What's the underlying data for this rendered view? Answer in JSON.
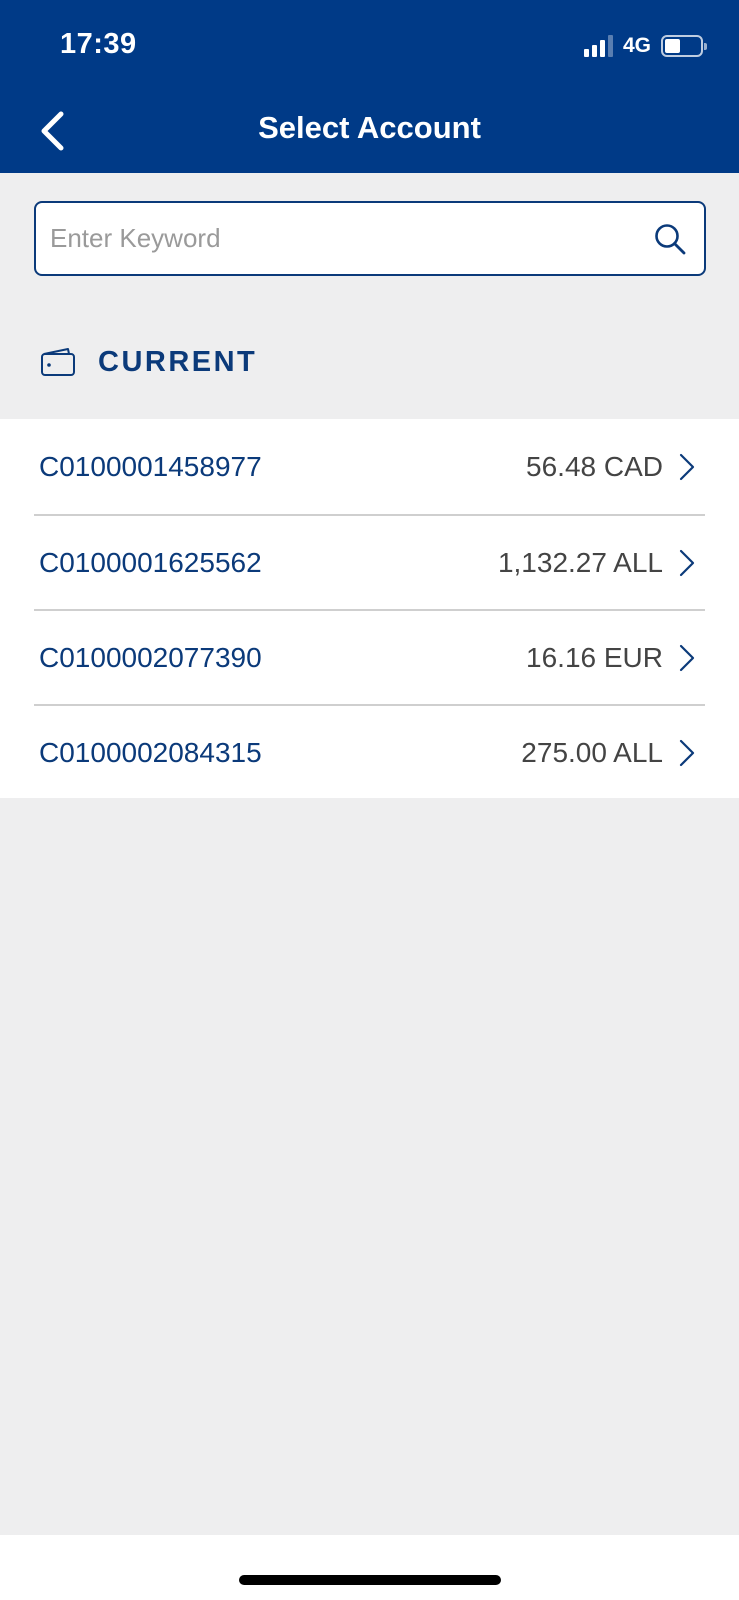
{
  "status_bar": {
    "time": "17:39",
    "network": "4G",
    "signal_bars_active": 3,
    "battery_level_percent": 40
  },
  "header": {
    "title": "Select Account",
    "background_color": "#003a87"
  },
  "search": {
    "placeholder": "Enter Keyword",
    "value": ""
  },
  "section": {
    "title": "CURRENT"
  },
  "accounts": [
    {
      "number": "C0100001458977",
      "balance": "56.48 CAD"
    },
    {
      "number": "C0100001625562",
      "balance": "1,132.27 ALL"
    },
    {
      "number": "C0100002077390",
      "balance": "16.16 EUR"
    },
    {
      "number": "C0100002084315",
      "balance": "275.00 ALL"
    }
  ],
  "colors": {
    "brand": "#003a87",
    "accent_text": "#0b3a7a",
    "background": "#eeeeef"
  }
}
